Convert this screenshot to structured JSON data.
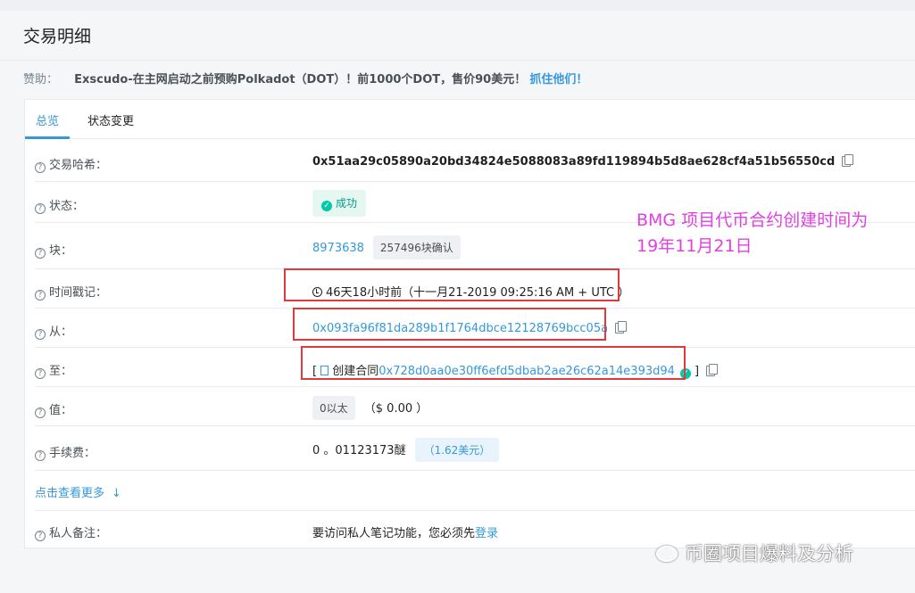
{
  "page": {
    "title": "交易明细"
  },
  "sponsor": {
    "label": "赞助：",
    "text": "Exscudo-在主网启动之前预购Polkadot（DOT）！前1000个DOT，售价90美元！",
    "link": "抓住他们！"
  },
  "tabs": [
    {
      "label": "总览",
      "active": true
    },
    {
      "label": "状态变更",
      "active": false
    }
  ],
  "details": {
    "tx_hash": {
      "label": "交易哈希：",
      "value": "0x51aa29c05890a20bd34824e5088083a89fd119894b5d8ae628cf4a51b56550cd"
    },
    "status": {
      "label": "状态：",
      "value": "成功"
    },
    "block": {
      "label": "块：",
      "number": "8973638",
      "confirmations": "257496块确认"
    },
    "timestamp": {
      "label": "时间戳记：",
      "value": "46天18小时前（十一月21-2019 09:25:16 AM + UTC ）"
    },
    "from": {
      "label": "从：",
      "value": "0x093fa96f81da289b1f1764dbce12128769bcc05a"
    },
    "to": {
      "label": "至：",
      "prefix": "[",
      "created_text": "创建合同",
      "address": "0x728d0aa0e30ff6efd5dbab2ae26c62a14e393d94",
      "suffix": "]"
    },
    "value": {
      "label": "值：",
      "amount": "0以太",
      "usd": "（$ 0.00 ）"
    },
    "fee": {
      "label": "手续费：",
      "amount": "0 。01123173醚",
      "usd": "（1.62美元）"
    },
    "note": {
      "label": "私人备注：",
      "text": "要访问私人笔记功能，您必须先",
      "link": "登录"
    }
  },
  "more": {
    "label": "点击查看更多"
  },
  "annotation": {
    "line1": "BMG 项目代币合约创建时间为",
    "line2": "19年11月21日",
    "color": "#e040e0"
  },
  "watermark": {
    "text": "币圈项目爆料及分析"
  },
  "colors": {
    "accent": "#3498db",
    "success": "#00c9a7",
    "highlight_box": "#e0393e"
  }
}
